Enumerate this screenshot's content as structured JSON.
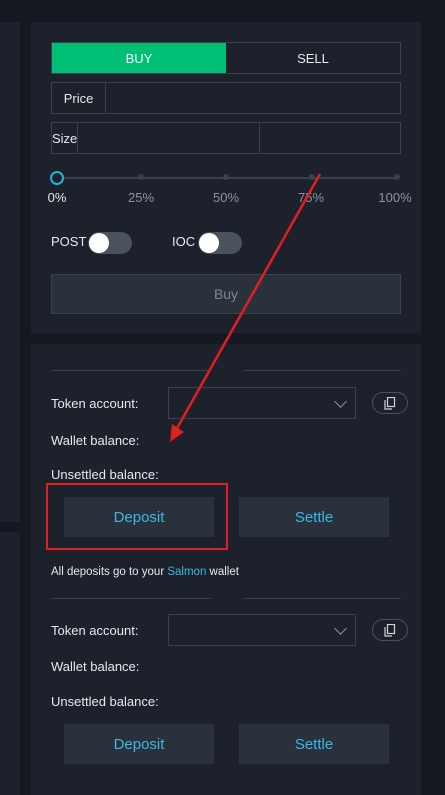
{
  "colors": {
    "accent_buy": "#02bf76",
    "link": "#3cb6e3",
    "highlight": "#e02020"
  },
  "order": {
    "tabs": {
      "buy": "BUY",
      "sell": "SELL"
    },
    "price_label": "Price",
    "size_label": "Size",
    "size_percent": 0,
    "slider_ticks": [
      "0%",
      "25%",
      "50%",
      "75%",
      "100%"
    ],
    "post_label": "POST",
    "ioc_label": "IOC",
    "buy_button": "Buy"
  },
  "wallet": {
    "section1": {
      "token_account_label": "Token account:",
      "wallet_balance_label": "Wallet balance:",
      "unsettled_balance_label": "Unsettled balance:",
      "deposit_button": "Deposit",
      "settle_button": "Settle"
    },
    "note_prefix": "All deposits go to your ",
    "note_link": "Salmon",
    "note_suffix": " wallet",
    "section2": {
      "token_account_label": "Token account:",
      "wallet_balance_label": "Wallet balance:",
      "unsettled_balance_label": "Unsettled balance:",
      "deposit_button": "Deposit",
      "settle_button": "Settle"
    }
  }
}
